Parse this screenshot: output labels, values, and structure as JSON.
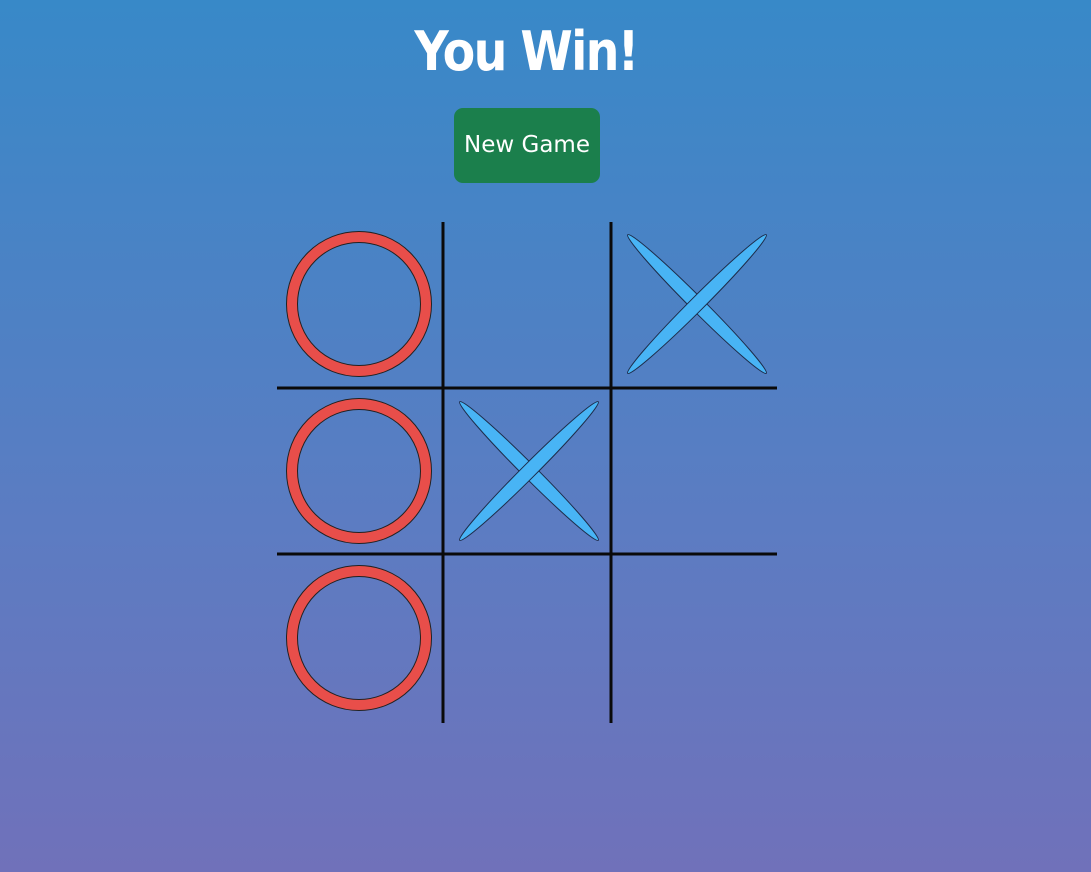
{
  "status": {
    "message": "You Win!"
  },
  "controls": {
    "new_game_label": "New Game"
  },
  "colors": {
    "o_mark": "#e84e4a",
    "x_mark": "#48b4f5",
    "grid": "#0a0a0a",
    "button": "#1b7f4c"
  },
  "board": {
    "cells": [
      "O",
      "",
      "X",
      "O",
      "X",
      "",
      "O",
      "",
      ""
    ],
    "winner": "O"
  }
}
